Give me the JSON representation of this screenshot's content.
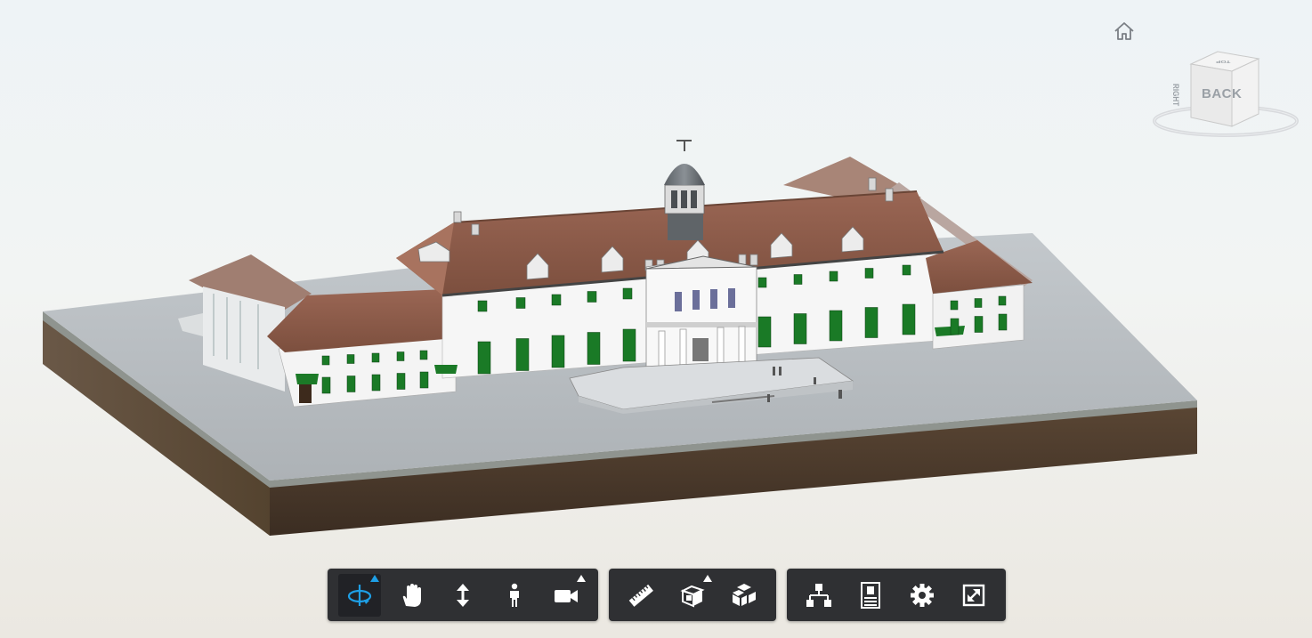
{
  "viewer": {
    "home_icon": "home-icon",
    "viewcube": {
      "back_label": "BACK",
      "right_label": "RIGHT",
      "top_label": "TOP"
    }
  },
  "toolbar": {
    "groups": [
      {
        "name": "navigation-tools",
        "tools": [
          {
            "icon": "orbit-icon",
            "active": true,
            "flyout": true
          },
          {
            "icon": "pan-hand-icon",
            "active": false,
            "flyout": false
          },
          {
            "icon": "dolly-zoom-icon",
            "active": false,
            "flyout": false
          },
          {
            "icon": "first-person-icon",
            "active": false,
            "flyout": false
          },
          {
            "icon": "camera-icon",
            "active": false,
            "flyout": true
          }
        ]
      },
      {
        "name": "modeling-tools",
        "tools": [
          {
            "icon": "measure-ruler-icon",
            "active": false,
            "flyout": false
          },
          {
            "icon": "section-box-icon",
            "active": false,
            "flyout": true
          },
          {
            "icon": "explode-model-icon",
            "active": false,
            "flyout": false
          }
        ]
      },
      {
        "name": "settings-tools",
        "tools": [
          {
            "icon": "model-browser-icon",
            "active": false,
            "flyout": false
          },
          {
            "icon": "properties-icon",
            "active": false,
            "flyout": false
          },
          {
            "icon": "settings-gear-icon",
            "active": false,
            "flyout": false
          },
          {
            "icon": "fullscreen-icon",
            "active": false,
            "flyout": false
          }
        ]
      }
    ],
    "colors": {
      "toolbar_bg": "#2f3033",
      "icon": "#ffffff",
      "active_accent": "#1e9fe6"
    }
  },
  "model": {
    "colors": {
      "roof": "#8a5a48",
      "wall": "#f2f2f2",
      "shutter": "#1a7a26",
      "ground": "#b9bec2",
      "soil": "#4a3a2c",
      "dome": "#6f7478"
    }
  }
}
